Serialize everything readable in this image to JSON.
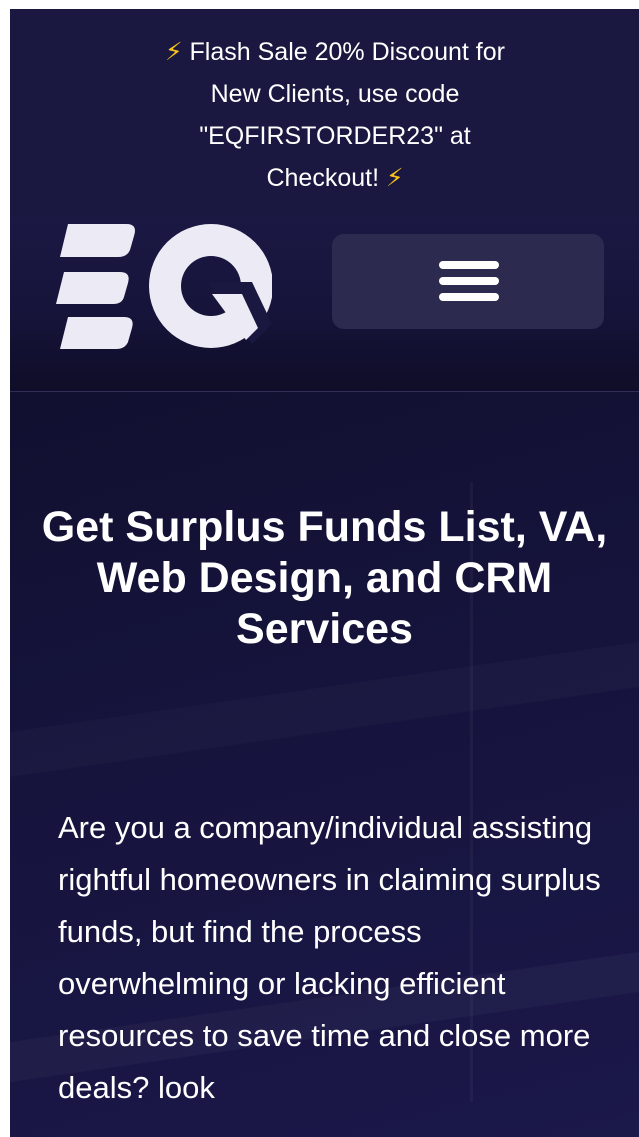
{
  "promo": {
    "text": "Flash Sale 20% Discount for New Clients, use code \"EQFIRSTORDER23\" at Checkout!",
    "icon": "lightning-bolt-icon",
    "icon_color": "#f7c21a"
  },
  "header": {
    "logo_text": "EQ",
    "menu_icon": "hamburger-menu-icon"
  },
  "hero": {
    "title": "Get Surplus Funds List, VA, Web Design, and CRM Services",
    "body": "Are you a company/individual assisting rightful homeowners in claiming surplus funds, but find the process overwhelming or lacking efficient resources to save time and close more deals? look"
  },
  "colors": {
    "background": "#13112e",
    "promo_background": "#1a1740",
    "menu_button": "#2c2a4e",
    "text": "#ffffff",
    "accent": "#f7c21a"
  }
}
